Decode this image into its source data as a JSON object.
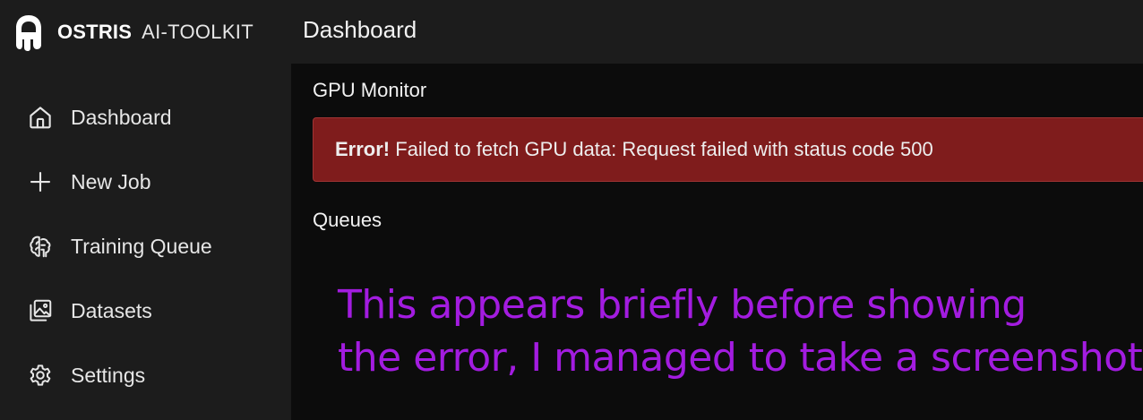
{
  "app": {
    "name": "OSTRIS",
    "subtitle": "AI-TOOLKIT",
    "logo_icon": "ostris-logo-icon"
  },
  "header": {
    "title": "Dashboard"
  },
  "sidebar": {
    "items": [
      {
        "label": "Dashboard",
        "icon": "home-icon"
      },
      {
        "label": "New Job",
        "icon": "plus-icon"
      },
      {
        "label": "Training Queue",
        "icon": "brain-icon"
      },
      {
        "label": "Datasets",
        "icon": "images-icon"
      },
      {
        "label": "Settings",
        "icon": "gear-icon"
      }
    ]
  },
  "main": {
    "gpu_monitor": {
      "title": "GPU Monitor",
      "error_prefix": "Error!",
      "error_message": "Failed to fetch GPU data: Request failed with status code 500"
    },
    "queues": {
      "title": "Queues"
    }
  },
  "annotation": {
    "line1": "This appears briefly before showing",
    "line2": "the error, I managed to take a screenshot.",
    "color": "#a31ce0"
  },
  "colors": {
    "background": "#0c0c0c",
    "sidebar": "#1c1c1c",
    "error_bg": "#7f1c1c",
    "error_border": "#a03434"
  }
}
